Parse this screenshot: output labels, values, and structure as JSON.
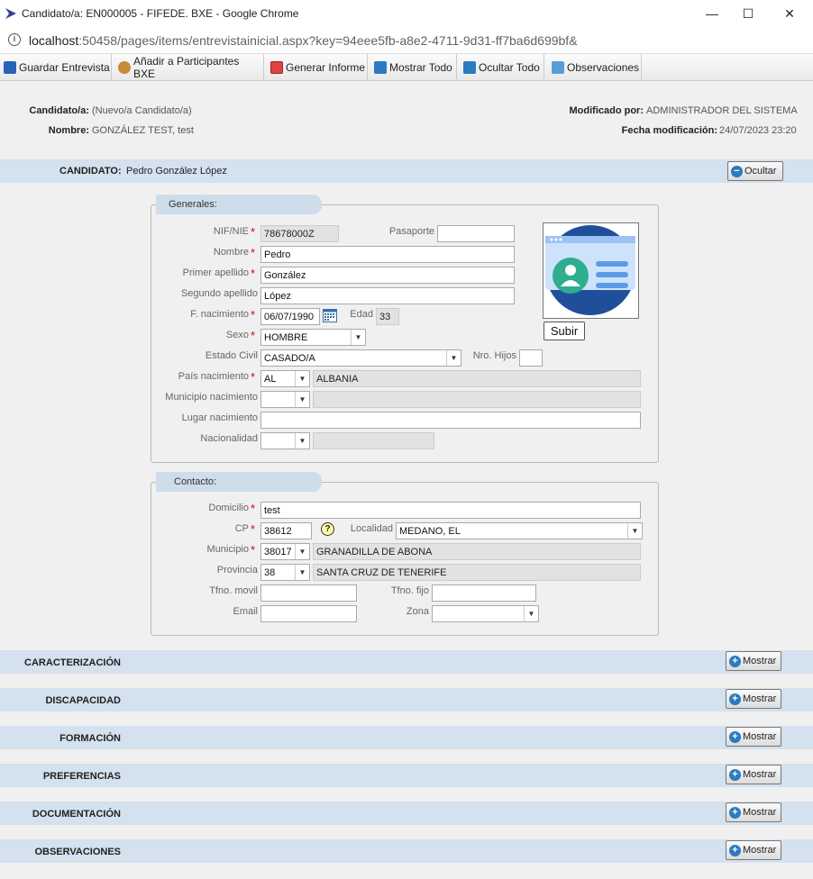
{
  "window": {
    "title": "Candidato/a: EN000005 - FIFEDE. BXE - Google Chrome"
  },
  "address": {
    "host": "localhost",
    "path": ":50458/pages/items/entrevistainicial.aspx?key=94eee5fb-a8e2-4711-9d31-ff7ba6d699bf&"
  },
  "toolbar": {
    "save": "Guardar Entrevista",
    "add": "Añadir a Participantes BXE",
    "report": "Generar Informe",
    "show_all": "Mostrar Todo",
    "hide_all": "Ocultar Todo",
    "notes": "Observaciones"
  },
  "header": {
    "candidate_label": "Candidato/a:",
    "candidate_value": "(Nuevo/a Candidato/a)",
    "name_label": "Nombre:",
    "name_value": "GONZÁLEZ TEST, test",
    "modified_by_label": "Modificado por:",
    "modified_by_value": "ADMINISTRADOR DEL SISTEMA",
    "modified_date_label": "Fecha modificación:",
    "modified_date_value": "24/07/2023 23:20"
  },
  "candidato": {
    "label": "CANDIDATO:",
    "value": "Pedro González López",
    "button": "Ocultar"
  },
  "generales": {
    "legend": "Generales:",
    "nif_label": "NIF/NIE",
    "nif": "78678000Z",
    "pasaporte_label": "Pasaporte",
    "pasaporte": "",
    "nombre_label": "Nombre",
    "nombre": "Pedro",
    "apellido1_label": "Primer apellido",
    "apellido1": "González",
    "apellido2_label": "Segundo apellido",
    "apellido2": "López",
    "fnac_label": "F. nacimiento",
    "fnac": "06/07/1990",
    "edad_label": "Edad",
    "edad": "33",
    "sexo_label": "Sexo",
    "sexo": "HOMBRE",
    "civil_label": "Estado Civil",
    "civil": "CASADO/A",
    "hijos_label": "Nro. Hijos",
    "hijos": "",
    "pais_label": "País nacimiento",
    "pais_code": "AL",
    "pais_name": "ALBANIA",
    "muni_label": "Municipio nacimiento",
    "muni_code": "",
    "muni_name": "",
    "lugar_label": "Lugar nacimiento",
    "lugar": "",
    "nac_label": "Nacionalidad",
    "nac_code": "",
    "nac_name": "",
    "upload": "Subir"
  },
  "contacto": {
    "legend": "Contacto:",
    "domicilio_label": "Domicilio",
    "domicilio": "test",
    "cp_label": "CP",
    "cp": "38612",
    "help": "?",
    "localidad_label": "Localidad",
    "localidad": "MEDANO, EL",
    "municipio_label": "Municipio",
    "municipio_code": "38017",
    "municipio_name": "GRANADILLA DE ABONA",
    "provincia_label": "Provincia",
    "provincia_code": "38",
    "provincia_name": "SANTA CRUZ DE TENERIFE",
    "movil_label": "Tfno. movil",
    "movil": "",
    "fijo_label": "Tfno. fijo",
    "fijo": "",
    "email_label": "Email",
    "email": "",
    "zona_label": "Zona",
    "zona": ""
  },
  "sections": [
    {
      "label": "CARACTERIZACIÓN",
      "button": "Mostrar"
    },
    {
      "label": "DISCAPACIDAD",
      "button": "Mostrar"
    },
    {
      "label": "FORMACIÓN",
      "button": "Mostrar"
    },
    {
      "label": "PREFERENCIAS",
      "button": "Mostrar"
    },
    {
      "label": "DOCUMENTACIÓN",
      "button": "Mostrar"
    },
    {
      "label": "OBSERVACIONES",
      "button": "Mostrar"
    }
  ]
}
